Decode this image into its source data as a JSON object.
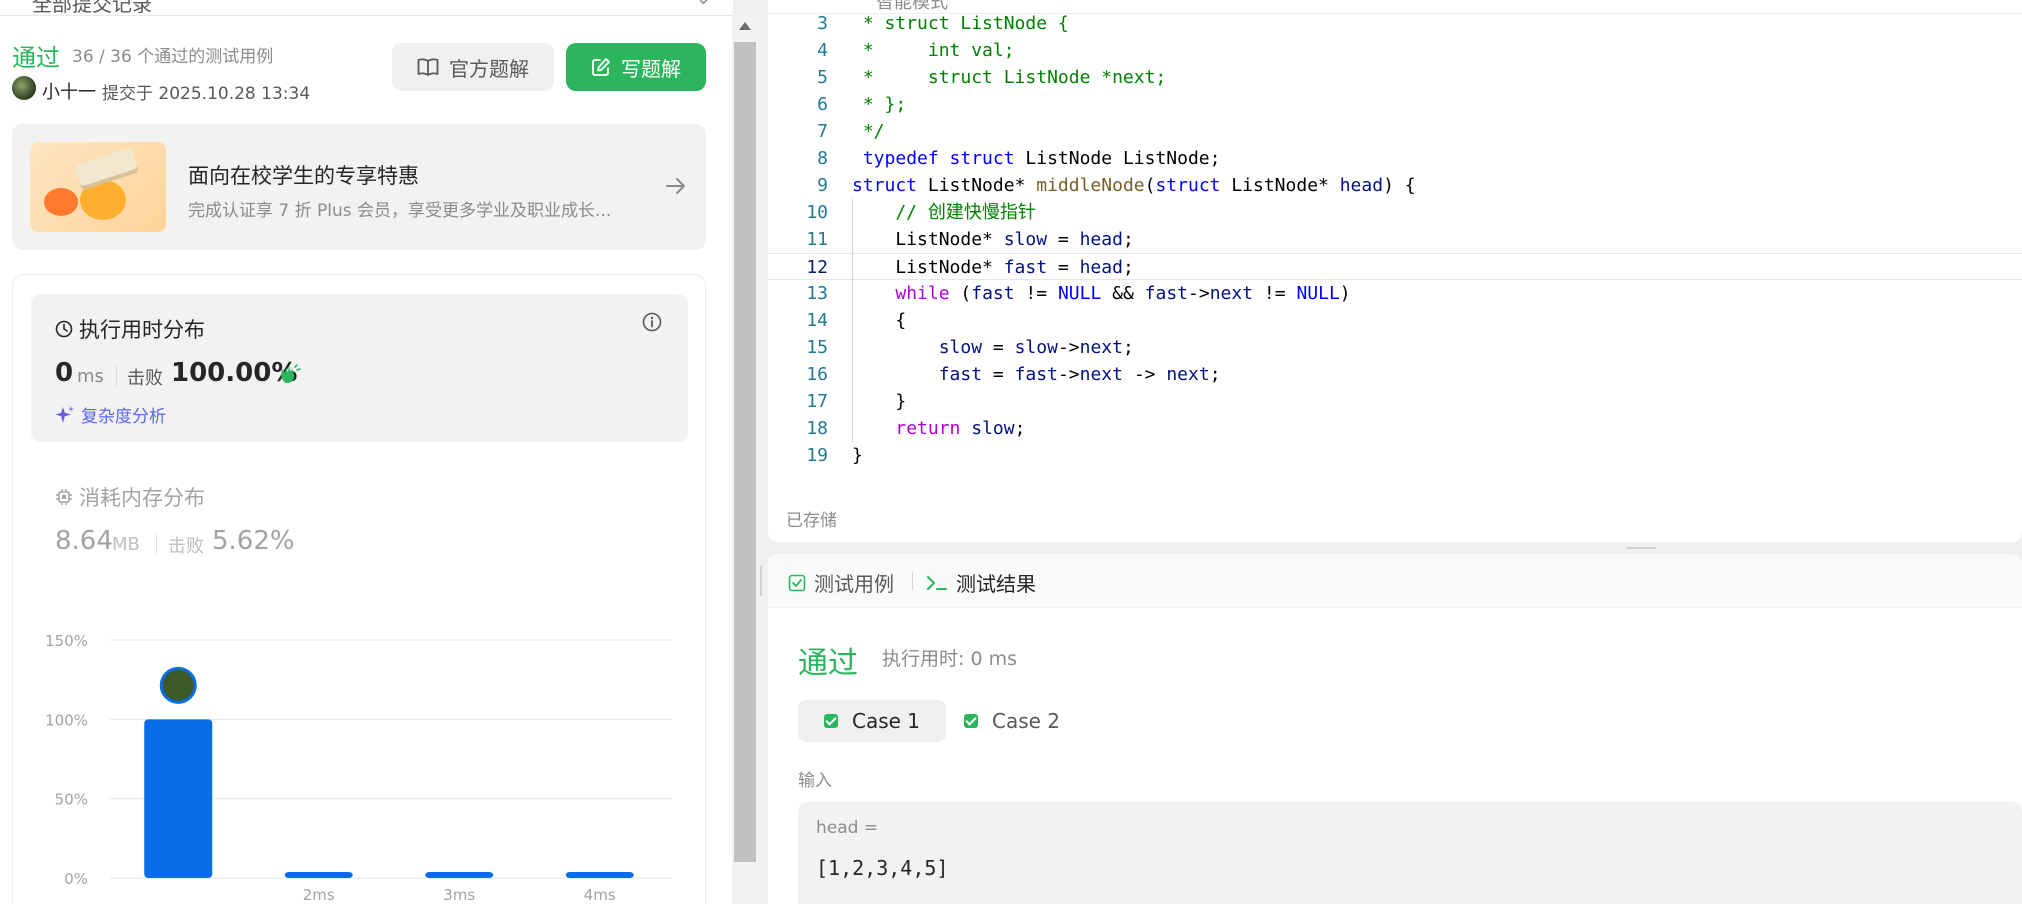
{
  "left_header": {
    "text": "全部提交记录"
  },
  "submission": {
    "status": "通过",
    "tests_passed": "36 / 36 个通过的测试用例",
    "submitter": "小十一",
    "submit_time": "提交于 2025.10.28 13:34"
  },
  "buttons": {
    "official_solution": "官方题解",
    "write_solution": "写题解"
  },
  "promo": {
    "title": "面向在校学生的专享特惠",
    "subtitle": "完成认证享 7 折 Plus 会员，享受更多学业及职业成长..."
  },
  "runtime": {
    "title": "执行用时分布",
    "value": "0",
    "unit": "ms",
    "beat_label": "击败",
    "beat": "100.00%",
    "complexity": "复杂度分析"
  },
  "memory": {
    "title": "消耗内存分布",
    "value": "8.64",
    "unit": "MB",
    "beat_label": "击败",
    "beat": "5.62%"
  },
  "chart_data": {
    "type": "bar",
    "categories": [
      "",
      "2ms",
      "3ms",
      "4ms"
    ],
    "values": [
      100,
      2,
      2,
      2
    ],
    "ytick_labels": [
      "150%",
      "100%",
      "50%",
      "0%"
    ],
    "ylim": [
      0,
      150
    ],
    "grid": true,
    "bar_color": "#0a6de6"
  },
  "editor": {
    "top_text": "智能模式",
    "saved": "已存储",
    "lines": [
      {
        "n": "3",
        "text": " * struct ListNode {"
      },
      {
        "n": "4",
        "text": " *     int val;"
      },
      {
        "n": "5",
        "text": " *     struct ListNode *next;"
      },
      {
        "n": "6",
        "text": " * };"
      },
      {
        "n": "7",
        "text": " */"
      },
      {
        "n": "8",
        "text": " typedef struct ListNode ListNode;"
      },
      {
        "n": "9",
        "text": "struct ListNode* middleNode(struct ListNode* head) {"
      },
      {
        "n": "10",
        "text": "    // 创建快慢指针"
      },
      {
        "n": "11",
        "text": "    ListNode* slow = head;"
      },
      {
        "n": "12",
        "text": "    ListNode* fast = head;"
      },
      {
        "n": "13",
        "text": "    while (fast != NULL && fast->next != NULL)"
      },
      {
        "n": "14",
        "text": "    {"
      },
      {
        "n": "15",
        "text": "        slow = slow->next;"
      },
      {
        "n": "16",
        "text": "        fast = fast->next -> next;"
      },
      {
        "n": "17",
        "text": "    }"
      },
      {
        "n": "18",
        "text": "    return slow;"
      },
      {
        "n": "19",
        "text": "}"
      }
    ]
  },
  "result_panel": {
    "tab_cases": "测试用例",
    "tab_result": "测试结果",
    "status": "通过",
    "runtime": "执行用时: 0 ms",
    "cases": [
      "Case 1",
      "Case 2"
    ],
    "input_label": "输入",
    "var_name": "head =",
    "var_value": "[1,2,3,4,5]"
  },
  "colors": {
    "accent_green": "#2db55d",
    "bar_blue": "#0a6de6",
    "link_purple": "#5b67e8"
  }
}
